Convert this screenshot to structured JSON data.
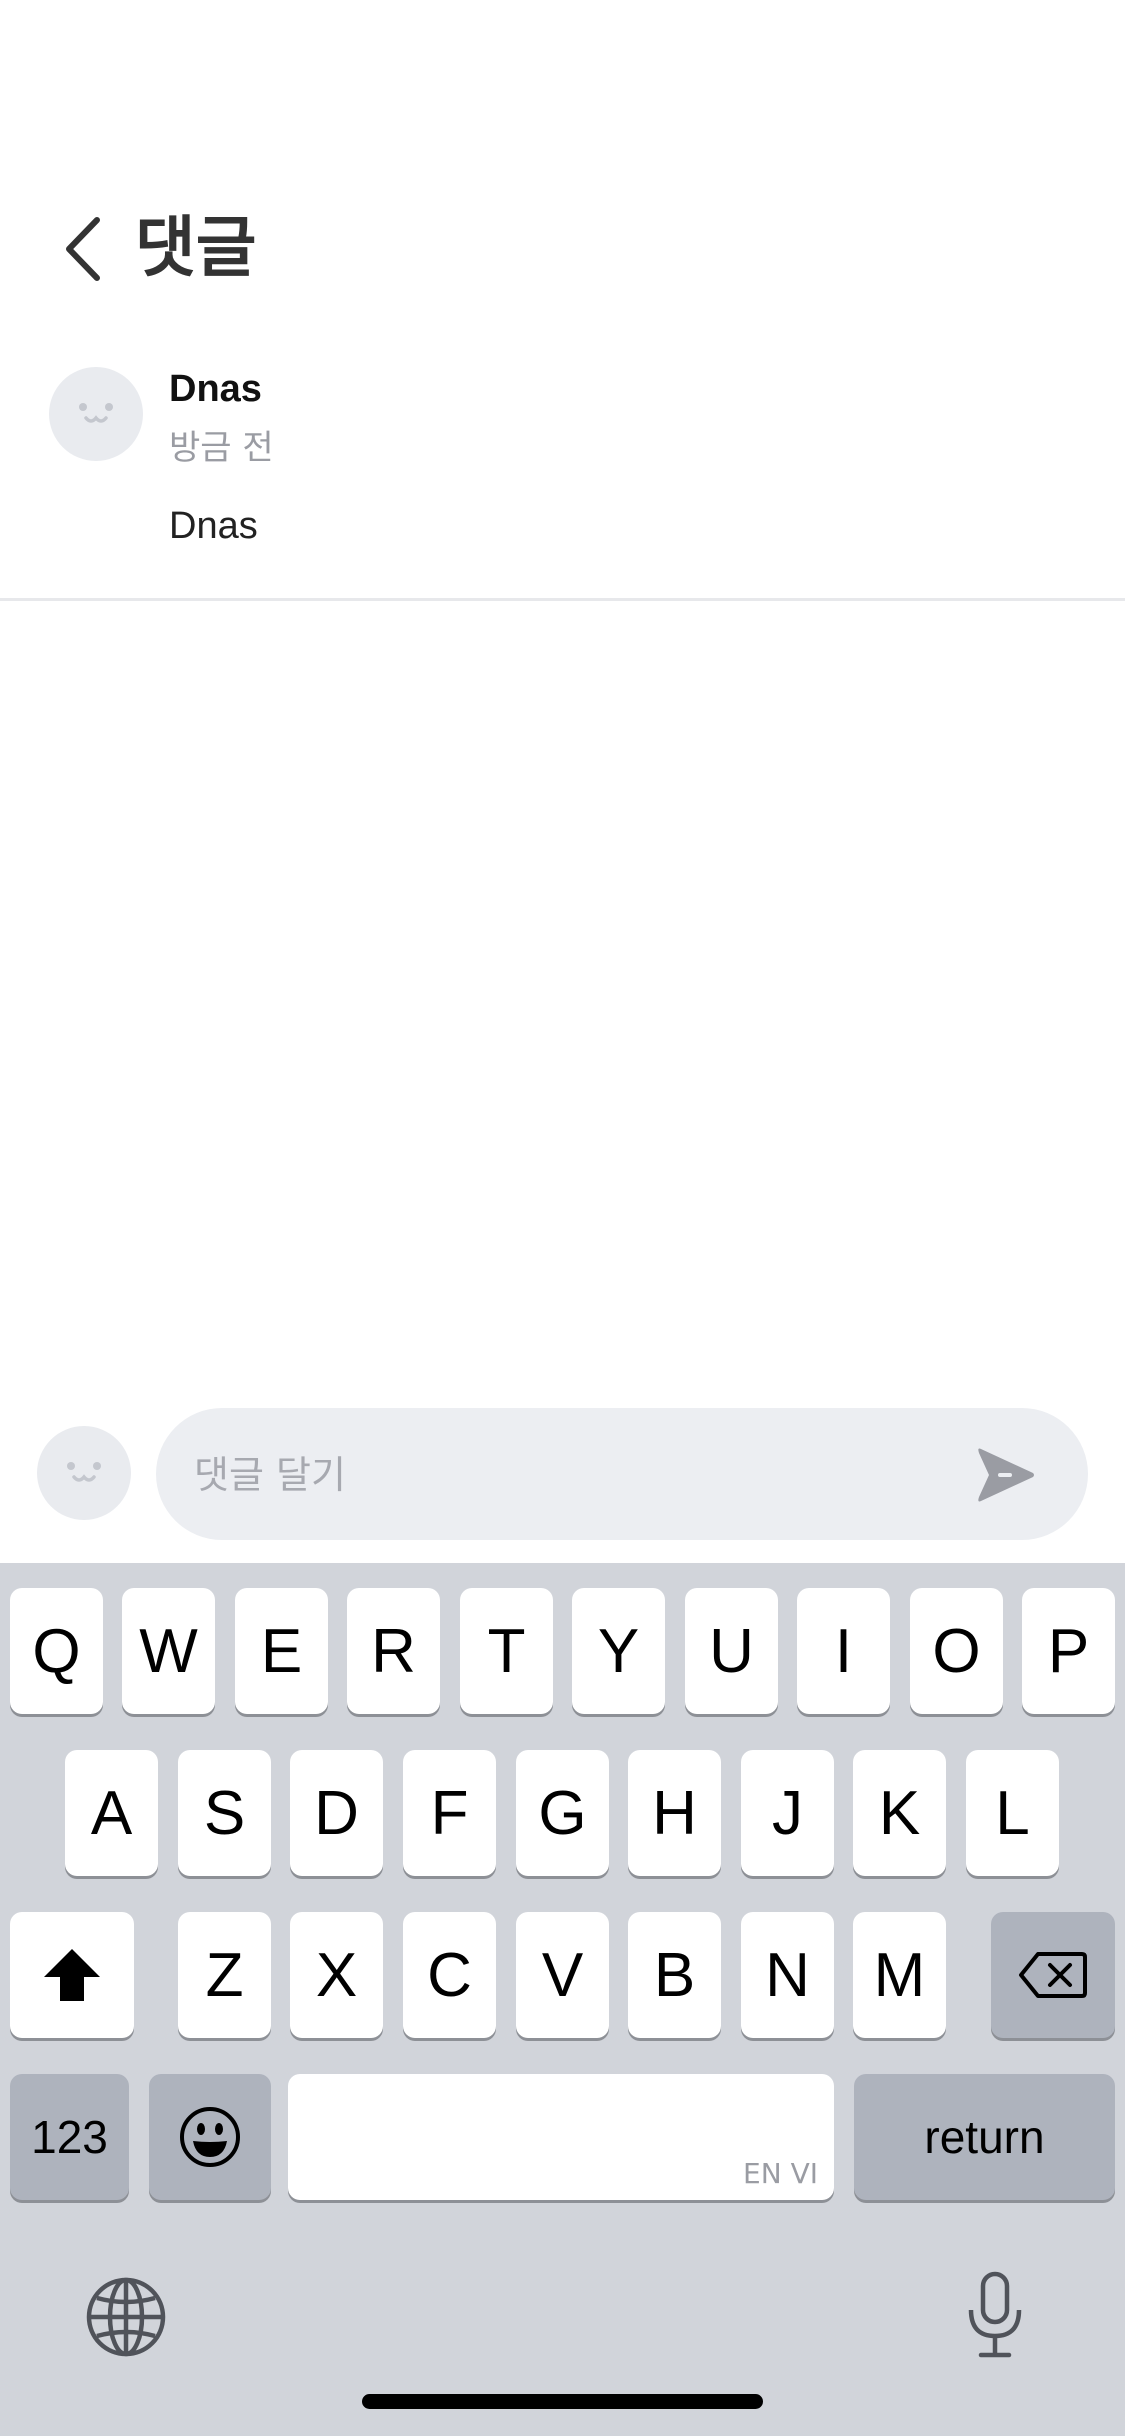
{
  "header": {
    "title": "댓글",
    "back_icon": "chevron-left-icon"
  },
  "comment": {
    "author": "Dnas",
    "time": "방금 전",
    "text": "Dnas",
    "avatar_icon": "cat-face-icon"
  },
  "input": {
    "placeholder": "댓글 달기",
    "value": "",
    "avatar_icon": "cat-face-icon",
    "send_icon": "send-icon"
  },
  "keyboard": {
    "row1": [
      "Q",
      "W",
      "E",
      "R",
      "T",
      "Y",
      "U",
      "I",
      "O",
      "P"
    ],
    "row2": [
      "A",
      "S",
      "D",
      "F",
      "G",
      "H",
      "J",
      "K",
      "L"
    ],
    "row3": [
      "Z",
      "X",
      "C",
      "V",
      "B",
      "N",
      "M"
    ],
    "numbers_label": "123",
    "return_label": "return",
    "space_hint": "EN VI",
    "shift_icon": "shift-icon",
    "delete_icon": "backspace-icon",
    "emoji_icon": "emoji-icon",
    "globe_icon": "globe-icon",
    "mic_icon": "microphone-icon"
  },
  "colors": {
    "keyboard_bg": "#d1d4da",
    "key_bg": "#ffffff",
    "key_dark": "#aeb3bd",
    "input_bg": "#eceef2",
    "avatar_bg": "#e9ebef"
  }
}
